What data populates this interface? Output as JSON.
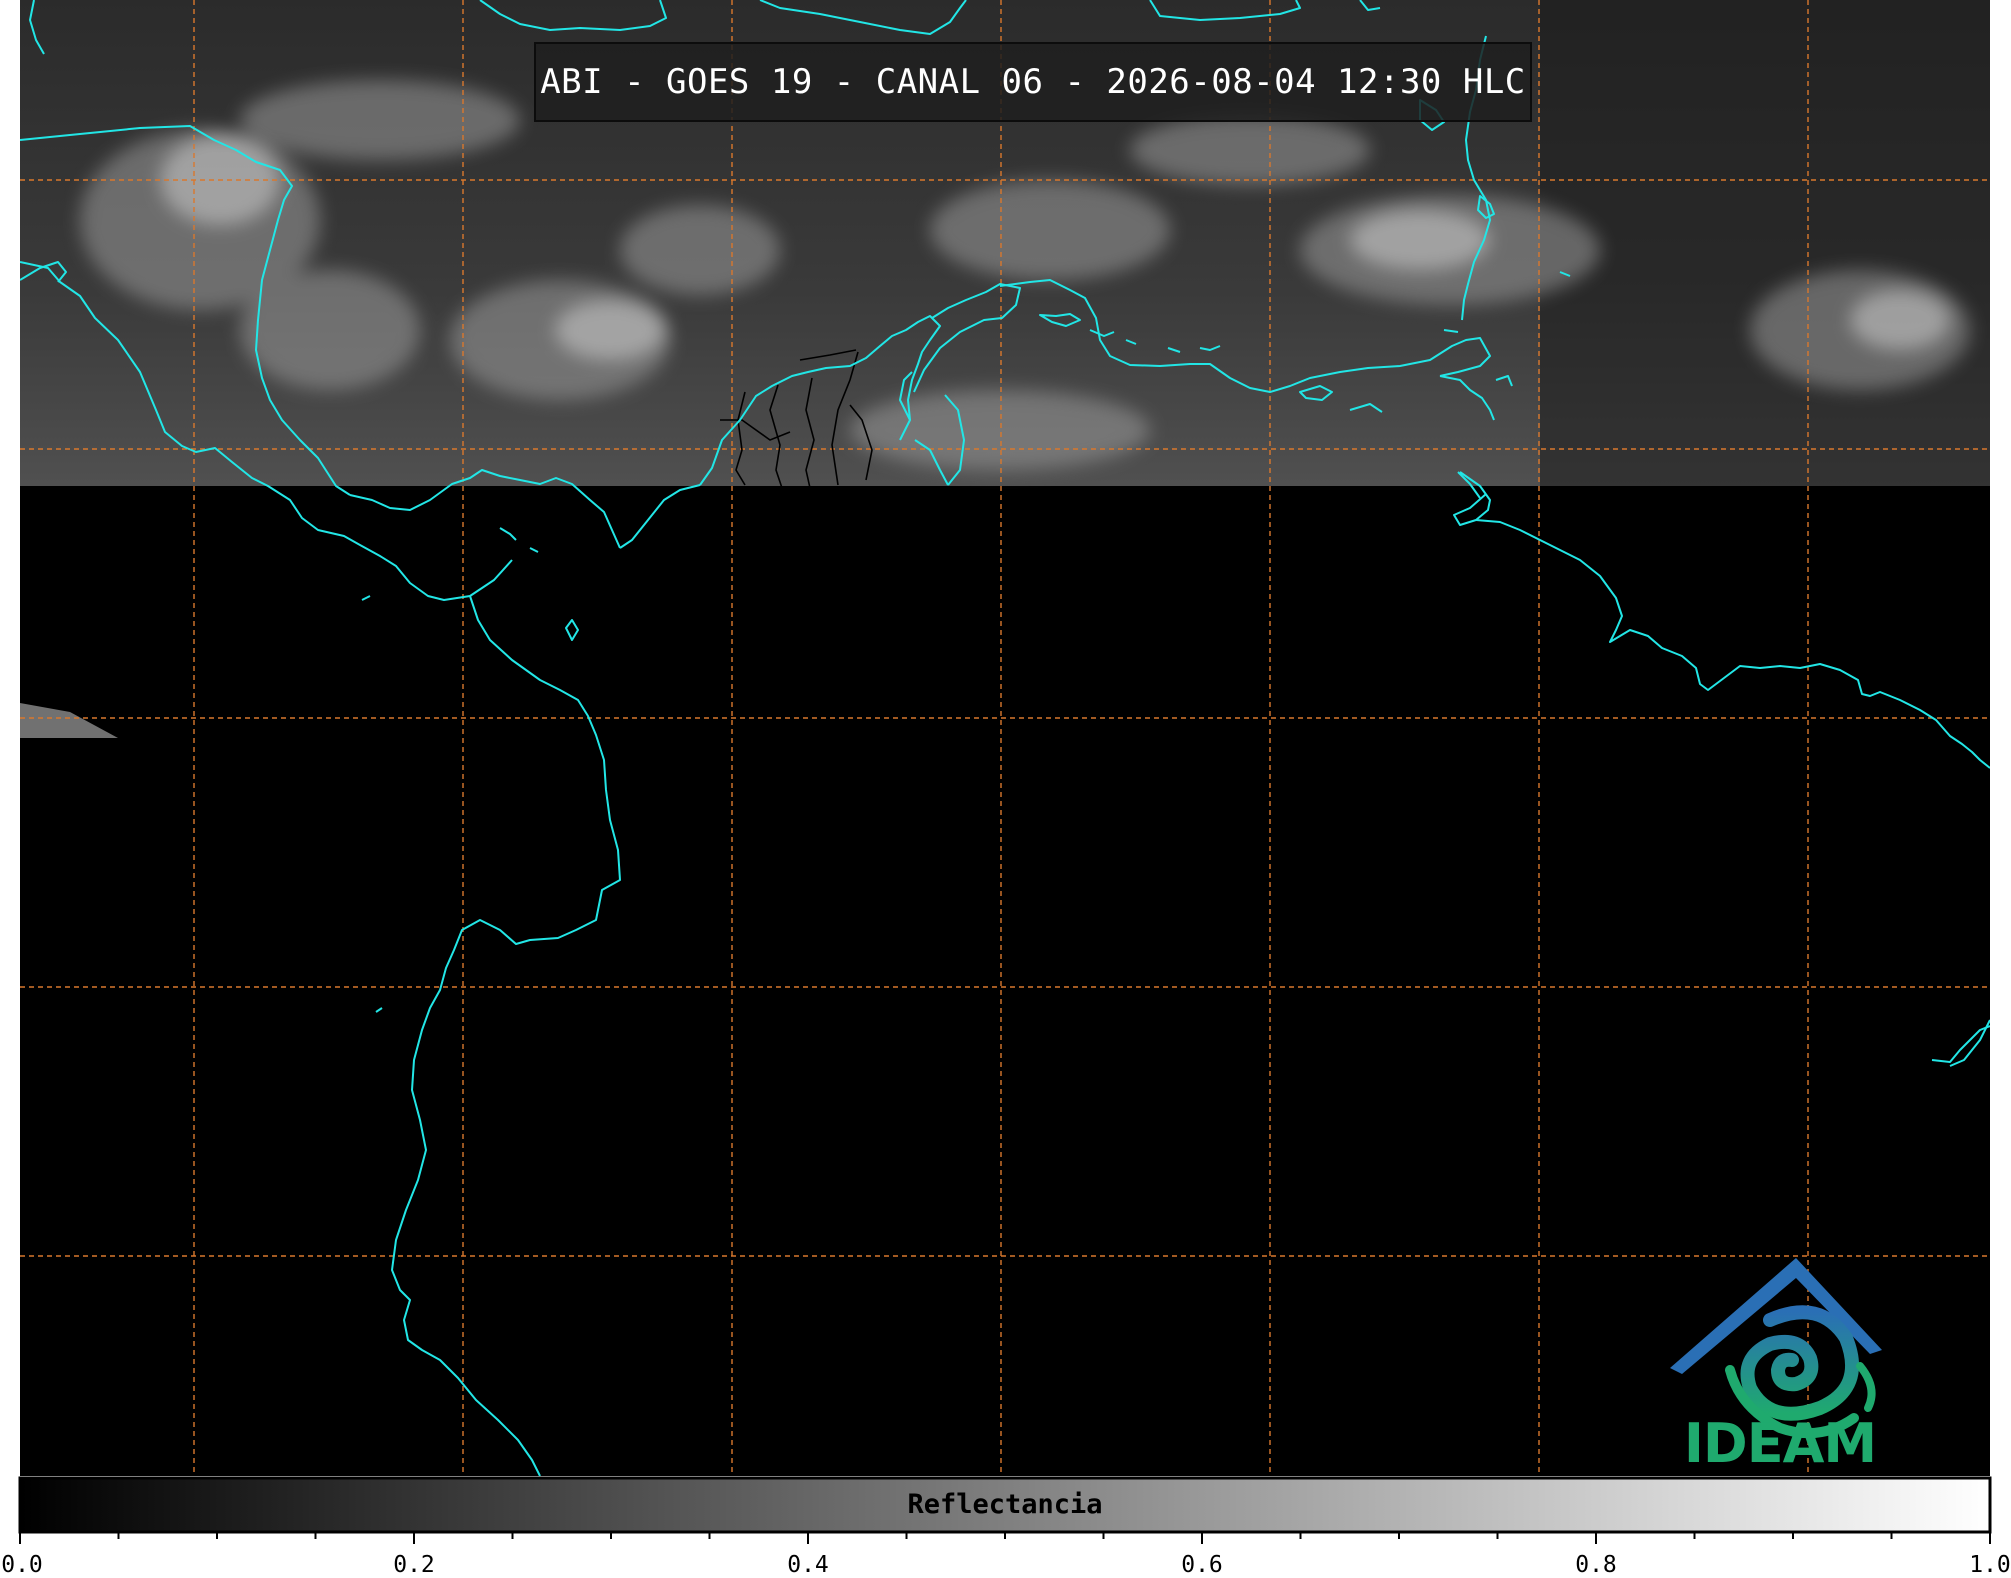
{
  "title": "ABI - GOES 19 - CANAL 06 - 2026-08-04 12:30 HLC",
  "colorbar": {
    "label": "Reflectancia",
    "ticks": [
      "0.0",
      "0.2",
      "0.4",
      "0.6",
      "0.8",
      "1.0"
    ],
    "tick_values": [
      0.0,
      0.2,
      0.4,
      0.6,
      0.8,
      1.0
    ],
    "min": 0.0,
    "max": 1.0,
    "colormap": [
      "#000000",
      "#ffffff"
    ]
  },
  "logo": {
    "text": "IDEAM",
    "icon": "ideam-mountain-swirl-icon",
    "colors": [
      "#2a6fb5",
      "#1faa6e"
    ]
  },
  "map": {
    "coastline_color": "#22e6e6",
    "grid_color": "#d9782d",
    "land_border_color": "#000000",
    "satellite_data_coverage": "top band only (northern Caribbean); remainder of scene shown black",
    "grid_style": "dashed"
  }
}
